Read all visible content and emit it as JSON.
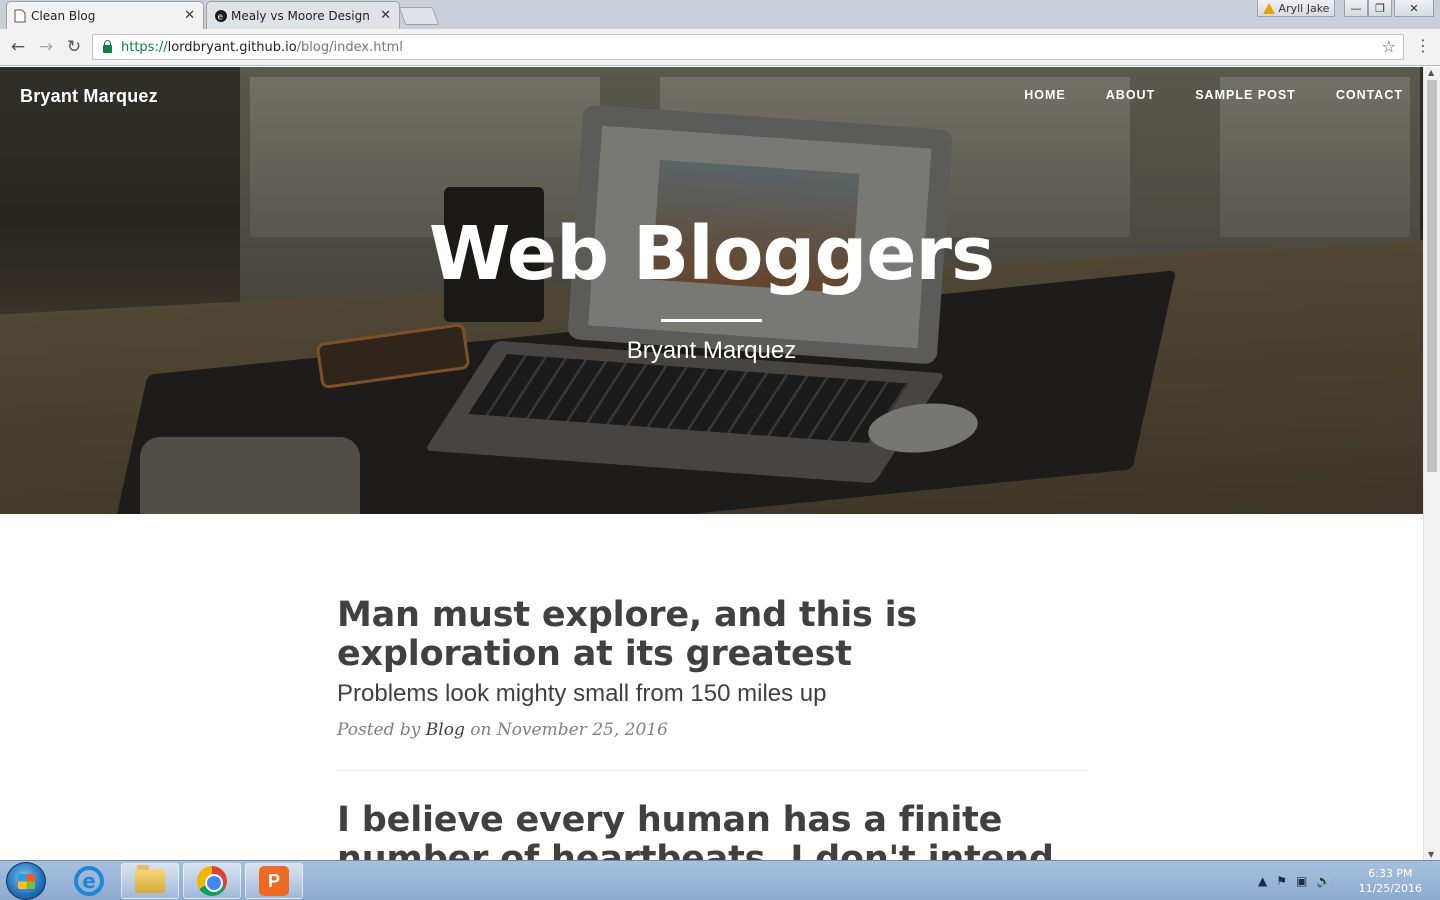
{
  "browser": {
    "tabs": [
      {
        "title": "Clean Blog",
        "active": true
      },
      {
        "title": "Mealy vs Moore Design",
        "active": false
      }
    ],
    "tab_close_glyph": "✕",
    "user_name": "Aryll Jake",
    "window_controls": [
      "—",
      "❐",
      "✕"
    ],
    "nav": {
      "back": "←",
      "forward": "→",
      "reload": "↻"
    },
    "url": {
      "scheme": "https://",
      "host": "lordbryant.github.io",
      "path": "/blog/index.html"
    },
    "bookmark_glyph": "☆",
    "menu_glyph": "⋮"
  },
  "site": {
    "brand": "Bryant Marquez",
    "nav": [
      "HOME",
      "ABOUT",
      "SAMPLE POST",
      "CONTACT"
    ],
    "hero": {
      "title": "Web Bloggers",
      "subtitle": "Bryant Marquez"
    },
    "posts": [
      {
        "title": "Man must explore, and this is exploration at its greatest",
        "subtitle": "Problems look mighty small from 150 miles up",
        "meta_prefix": "Posted by ",
        "author": "Blog",
        "meta_mid": " on ",
        "date": "November 25, 2016"
      },
      {
        "title": "I believe every human has a finite number of heartbeats. I don't intend to"
      }
    ]
  },
  "scrollbar": {
    "up": "▲",
    "down": "▼"
  },
  "taskbar": {
    "ie_glyph": "e",
    "ppt_glyph": "P",
    "tray": [
      "▲",
      "⚑",
      "▣",
      "🔊"
    ],
    "clock_time": "6:33 PM",
    "clock_date": "11/25/2016"
  },
  "colors": {
    "accent_green": "#0b8043",
    "post_text": "#404040",
    "meta_text": "#808080"
  }
}
